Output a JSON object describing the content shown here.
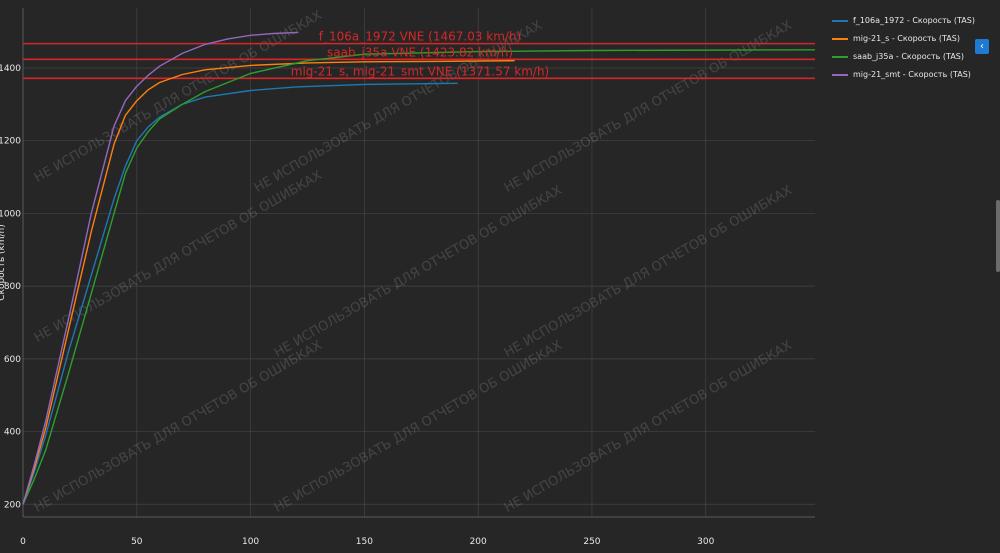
{
  "chart_data": {
    "type": "line",
    "xlabel": "",
    "ylabel": "Скорость (km/h)",
    "xlim": [
      0,
      348
    ],
    "ylim": [
      165,
      1565
    ],
    "x_ticks": [
      0,
      50,
      100,
      150,
      200,
      250,
      300
    ],
    "y_ticks": [
      200,
      400,
      600,
      800,
      1000,
      1200,
      1400
    ],
    "grid": true,
    "legend_position": "right",
    "series": [
      {
        "name": "f_106a_1972 - Скорость (TAS)",
        "color": "#1f77b4",
        "x": [
          0,
          5,
          10,
          20,
          30,
          40,
          45,
          50,
          55,
          60,
          70,
          80,
          100,
          120,
          150,
          191
        ],
        "y": [
          200,
          290,
          390,
          620,
          830,
          1040,
          1130,
          1200,
          1238,
          1265,
          1300,
          1320,
          1338,
          1348,
          1355,
          1358
        ]
      },
      {
        "name": "mig-21_s - Скорость (TAS)",
        "color": "#ff7f0e",
        "x": [
          0,
          5,
          10,
          20,
          30,
          40,
          45,
          50,
          55,
          60,
          70,
          80,
          100,
          125,
          150,
          180,
          216
        ],
        "y": [
          200,
          300,
          410,
          680,
          950,
          1190,
          1270,
          1310,
          1340,
          1360,
          1382,
          1395,
          1407,
          1414,
          1417,
          1418,
          1420
        ]
      },
      {
        "name": "saab_j35a - Скорость (TAS)",
        "color": "#2ca02c",
        "x": [
          0,
          5,
          10,
          20,
          30,
          40,
          45,
          50,
          55,
          60,
          70,
          80,
          100,
          125,
          150,
          200,
          250,
          348
        ],
        "y": [
          200,
          270,
          350,
          560,
          780,
          1000,
          1110,
          1180,
          1225,
          1260,
          1300,
          1335,
          1385,
          1420,
          1438,
          1445,
          1448,
          1450
        ]
      },
      {
        "name": "mig-21_smt - Скорость (TAS)",
        "color": "#9467bd",
        "x": [
          0,
          5,
          10,
          20,
          30,
          40,
          45,
          50,
          55,
          60,
          70,
          80,
          90,
          100,
          110,
          121
        ],
        "y": [
          200,
          310,
          430,
          710,
          1000,
          1240,
          1310,
          1350,
          1380,
          1405,
          1440,
          1465,
          1480,
          1490,
          1495,
          1498
        ]
      }
    ],
    "reference_lines": [
      {
        "name": "f_106a_1972 VNE (1467.03 km/h)",
        "y": 1467.03,
        "color": "#d62728"
      },
      {
        "name": "saab_j35a VNE (1423.82 km/h)",
        "y": 1423.82,
        "color": "#d62728"
      },
      {
        "name": "mig-21_s, mig-21_smt VNE (1371.57 km/h)",
        "y": 1371.57,
        "color": "#d62728"
      }
    ],
    "watermark": "НЕ ИСПОЛЬЗОВАТЬ ДЛЯ ОТЧЕТОВ ОБ ОШИБКАХ"
  },
  "colors": {
    "background": "#262626",
    "grid": "#444444",
    "axis_text": "#e8e8e8",
    "accent": "#1f7ad3"
  },
  "icons": {
    "collapse": "chevron-left-icon"
  }
}
